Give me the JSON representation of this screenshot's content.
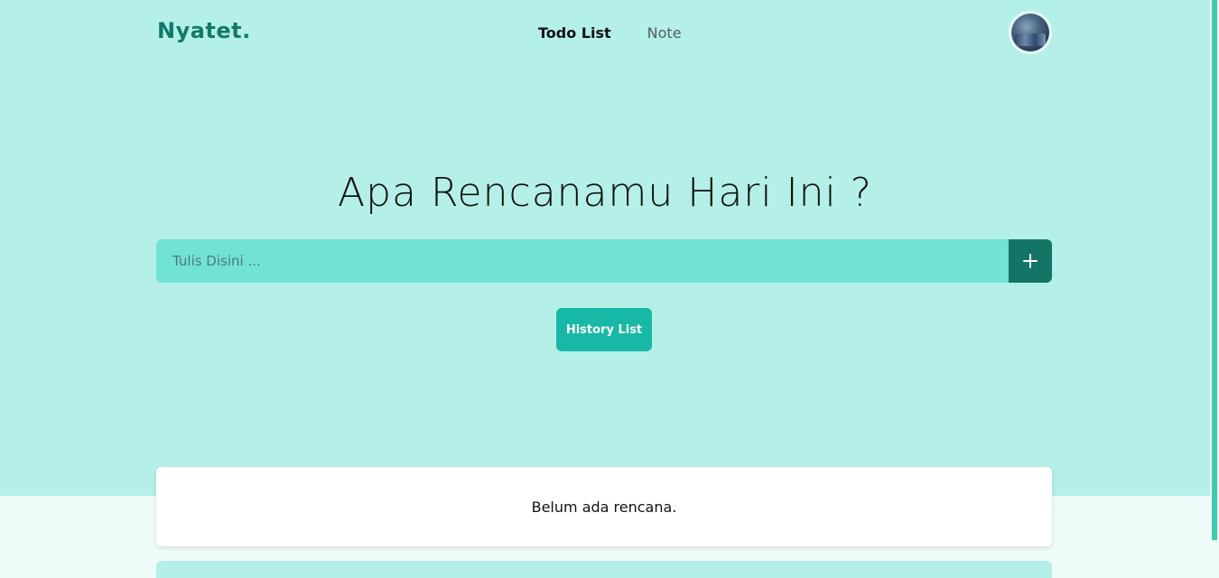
{
  "header": {
    "logo": "Nyatet.",
    "nav": [
      {
        "label": "Todo List",
        "active": true
      },
      {
        "label": "Note",
        "active": false
      }
    ]
  },
  "hero": {
    "headline": "Apa Rencanamu Hari Ini ?",
    "input_placeholder": "Tulis Disini ...",
    "input_value": "",
    "add_icon": "plus-icon",
    "history_button": "History List"
  },
  "todos": {
    "empty_message": "Belum ada rencana."
  },
  "colors": {
    "hero_bg": "#b4f0e8",
    "brand": "#127a6c",
    "input_bg": "#72e2d4",
    "add_button": "#127566",
    "history_button": "#17b9a6"
  }
}
